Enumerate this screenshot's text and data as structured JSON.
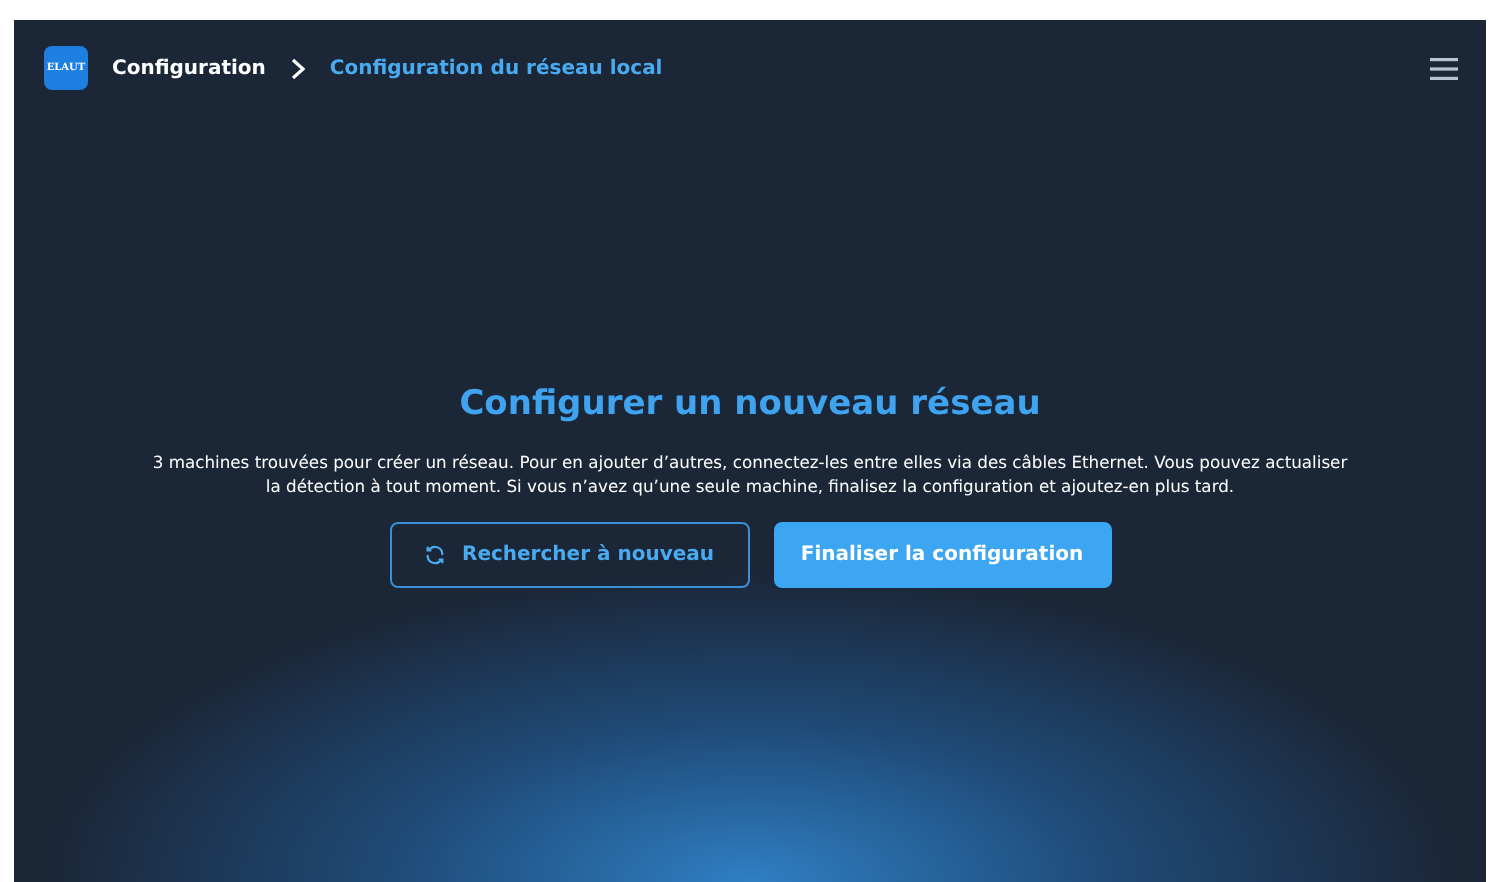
{
  "header": {
    "logo": "ELAUT",
    "breadcrumb": [
      {
        "label": "Configuration",
        "selected": false
      },
      {
        "label": "Configuration du réseau local",
        "selected": true
      }
    ]
  },
  "main": {
    "title": "Configurer un nouveau réseau",
    "description": "3 machines trouvées pour créer un réseau. Pour en ajouter d’autres, connectez-les entre elles via des câbles Ethernet. Vous pouvez actualiser la détection à tout moment. Si vous n’avez qu’une seule machine, finalisez la configuration et ajoutez-en plus tard.",
    "buttons": [
      {
        "kind": "outline",
        "label": "Rechercher à nouveau"
      },
      {
        "kind": "primary",
        "label": "Finaliser la configuration"
      }
    ]
  }
}
